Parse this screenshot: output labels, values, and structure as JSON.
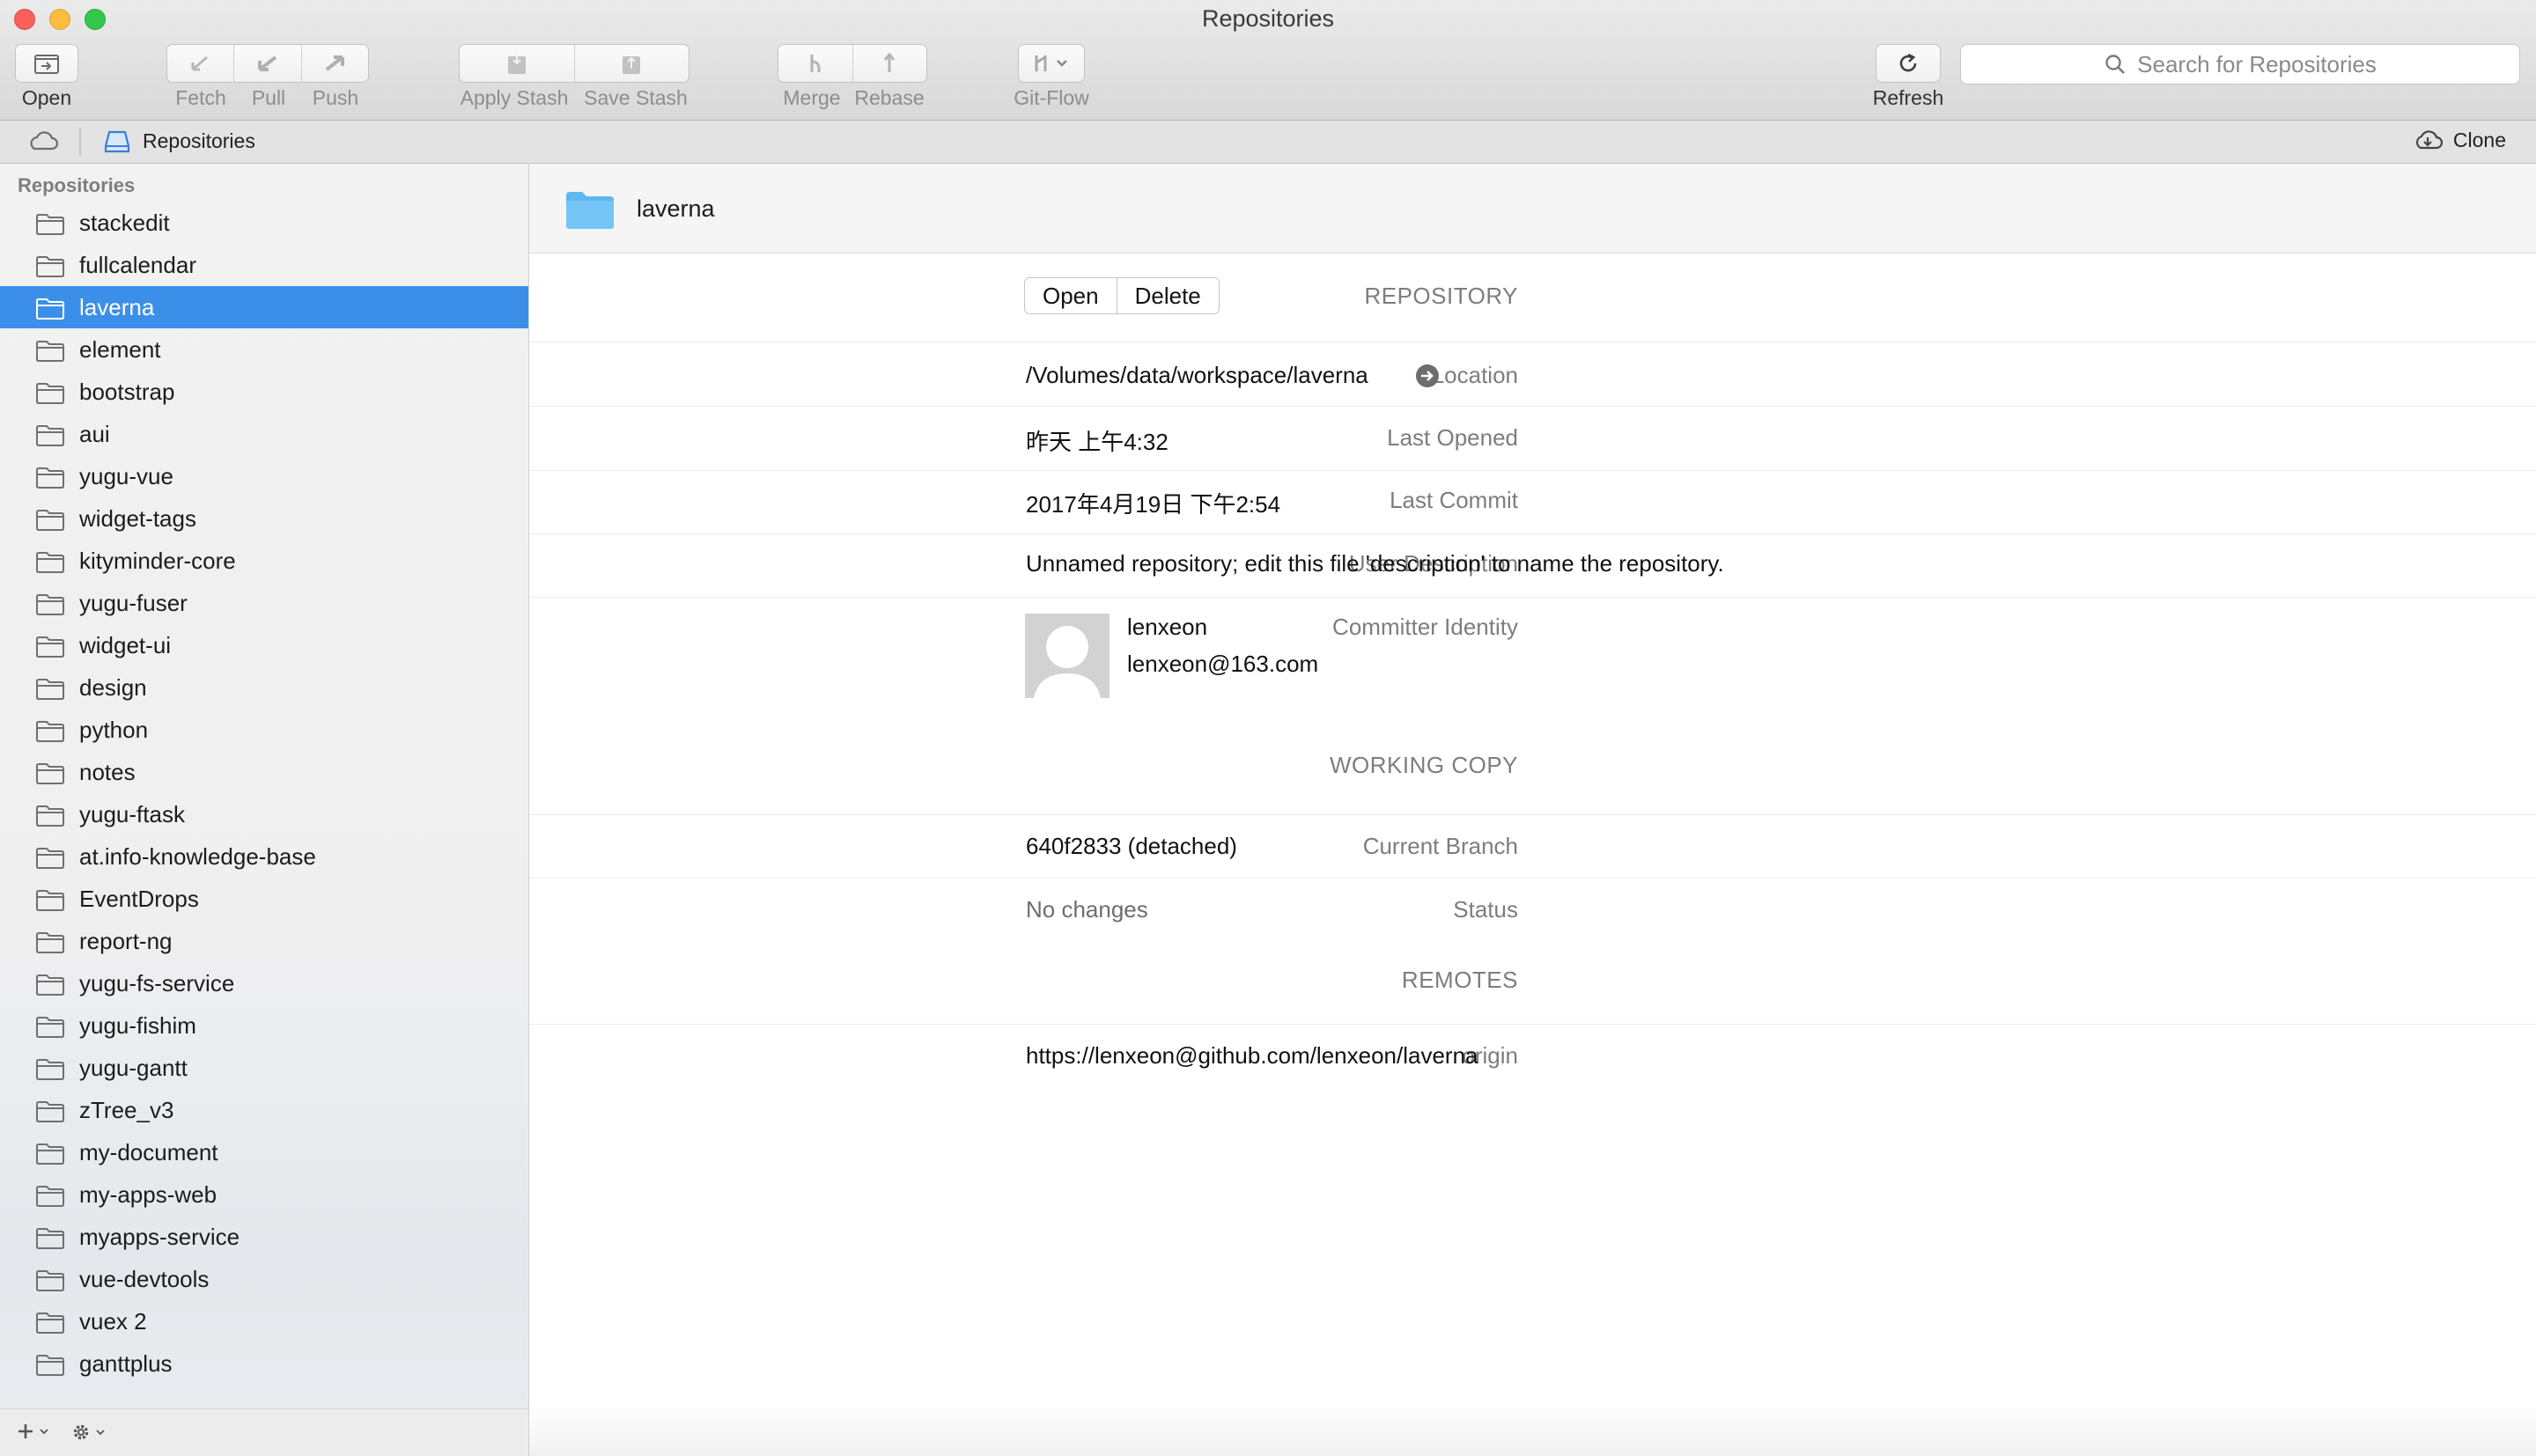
{
  "window": {
    "title": "Repositories"
  },
  "toolbar": {
    "open_label": "Open",
    "fetch_label": "Fetch",
    "pull_label": "Pull",
    "push_label": "Push",
    "apply_stash_label": "Apply Stash",
    "save_stash_label": "Save Stash",
    "merge_label": "Merge",
    "rebase_label": "Rebase",
    "gitflow_label": "Git-Flow",
    "refresh_label": "Refresh",
    "search_placeholder": "Search for Repositories"
  },
  "pathbar": {
    "crumb": "Repositories",
    "clone_label": "Clone"
  },
  "sidebar": {
    "title": "Repositories",
    "selected": "laverna",
    "items": [
      "stackedit",
      "fullcalendar",
      "laverna",
      "element",
      "bootstrap",
      "aui",
      "yugu-vue",
      "widget-tags",
      "kityminder-core",
      "yugu-fuser",
      "widget-ui",
      "design",
      "python",
      "notes",
      "yugu-ftask",
      "at.info-knowledge-base",
      "EventDrops",
      "report-ng",
      "yugu-fs-service",
      "yugu-fishim",
      "yugu-gantt",
      "zTree_v3",
      "my-document",
      "my-apps-web",
      "myapps-service",
      "vue-devtools",
      "vuex 2",
      "ganttplus"
    ]
  },
  "detail": {
    "header_name": "laverna",
    "repository_section": "REPOSITORY",
    "open_button": "Open",
    "delete_button": "Delete",
    "location_label": "Location",
    "location_value": "/Volumes/data/workspace/laverna",
    "last_opened_label": "Last Opened",
    "last_opened_value": "昨天 上午4:32",
    "last_commit_label": "Last Commit",
    "last_commit_value": "2017年4月19日 下午2:54",
    "user_description_label": "User Description",
    "user_description_value": "Unnamed repository; edit this file 'description' to name the repository.",
    "committer_label": "Committer Identity",
    "committer_name": "lenxeon",
    "committer_email": "lenxeon@163.com",
    "working_copy_section": "WORKING COPY",
    "current_branch_label": "Current Branch",
    "current_branch_value": "640f2833 (detached)",
    "status_label": "Status",
    "status_value": "No changes",
    "remotes_section": "REMOTES",
    "origin_label": "origin",
    "origin_value": "https://lenxeon@github.com/lenxeon/laverna"
  },
  "colors": {
    "selection": "#3b8fe9",
    "folder": "#5fb7ef"
  }
}
